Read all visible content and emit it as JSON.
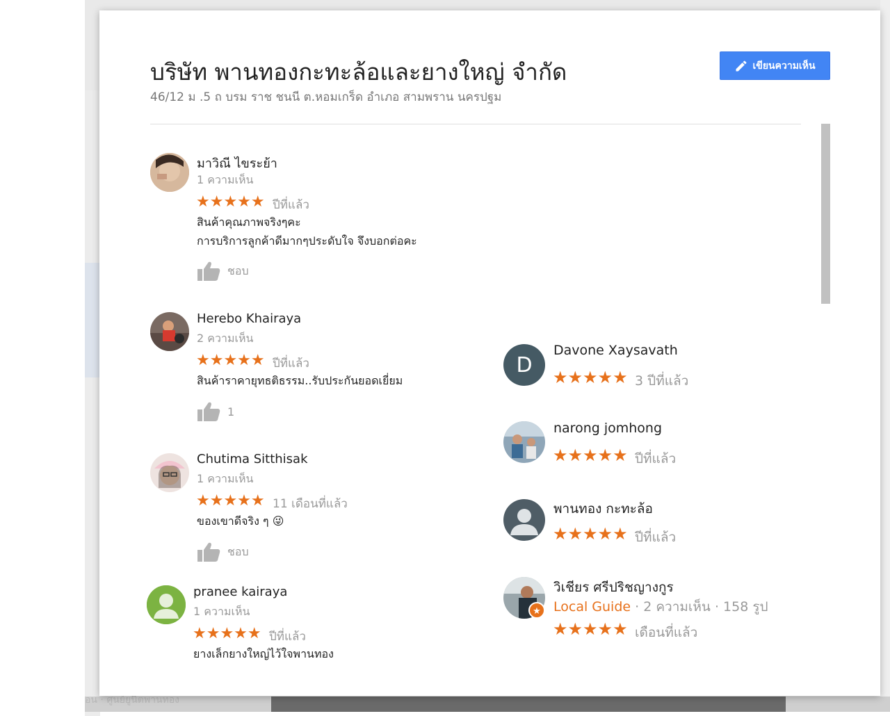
{
  "place": {
    "title": "บริษัท พานทองกะทะล้อและยางใหญ่ จำกัด",
    "address": "46/12 ม .5 ถ บรม ราช ชนนี ต.หอมเกร็ด อำเภอ สามพราน นครปฐม",
    "write_review_label": "เขียนความเห็น"
  },
  "colors": {
    "accent": "#4285f4",
    "stars": "#e7711b"
  },
  "reviews_left": [
    {
      "name": "มาวิณี ไขระย้า",
      "count": "1 ความเห็น",
      "stars": "★★★★★",
      "when": "ปีที่แล้ว",
      "text_line1": "สินค้าคุณภาพจริงๆคะ",
      "text_line2": "การบริการลูกค้าดีมากๆประดับใจ จึงบอกต่อคะ",
      "like_label": "ชอบ"
    },
    {
      "name": "Herebo Khairaya",
      "count": "2 ความเห็น",
      "stars": "★★★★★",
      "when": "ปีที่แล้ว",
      "text_line1": "สินค้าราคายุทธติธรรม..รับประกันยอดเยี่ยม",
      "like_label": "1"
    },
    {
      "name": "Chutima Sitthisak",
      "count": "1 ความเห็น",
      "stars": "★★★★★",
      "when": "11 เดือนที่แล้ว",
      "text_line1": "ของเขาดีจริง ๆ 😜",
      "like_label": "ชอบ"
    },
    {
      "name": "pranee kairaya",
      "count": "1 ความเห็น",
      "stars": "★★★★★",
      "when": "ปีที่แล้ว",
      "text_line1": "ยางเล็กยางใหญ่ไว้ใจพานทอง"
    }
  ],
  "reviews_right": [
    {
      "name": "Davone Xaysavath",
      "initial": "D",
      "stars": "★★★★★",
      "when": "3 ปีที่แล้ว"
    },
    {
      "name": "narong jomhong",
      "stars": "★★★★★",
      "when": "ปีที่แล้ว"
    },
    {
      "name": "พานทอง กะทะล้อ",
      "stars": "★★★★★",
      "when": "ปีที่แล้ว"
    },
    {
      "name": "วิเชียร ศรีปริชญางกูร",
      "local_guide": "Local Guide",
      "meta": " · 2 ความเห็น · 158 รูป",
      "stars": "★★★★★",
      "when": "เดือนที่แล้ว"
    }
  ],
  "background": {
    "bottom_text": "อน · ศูนย์ยูนิตพานทอง"
  }
}
